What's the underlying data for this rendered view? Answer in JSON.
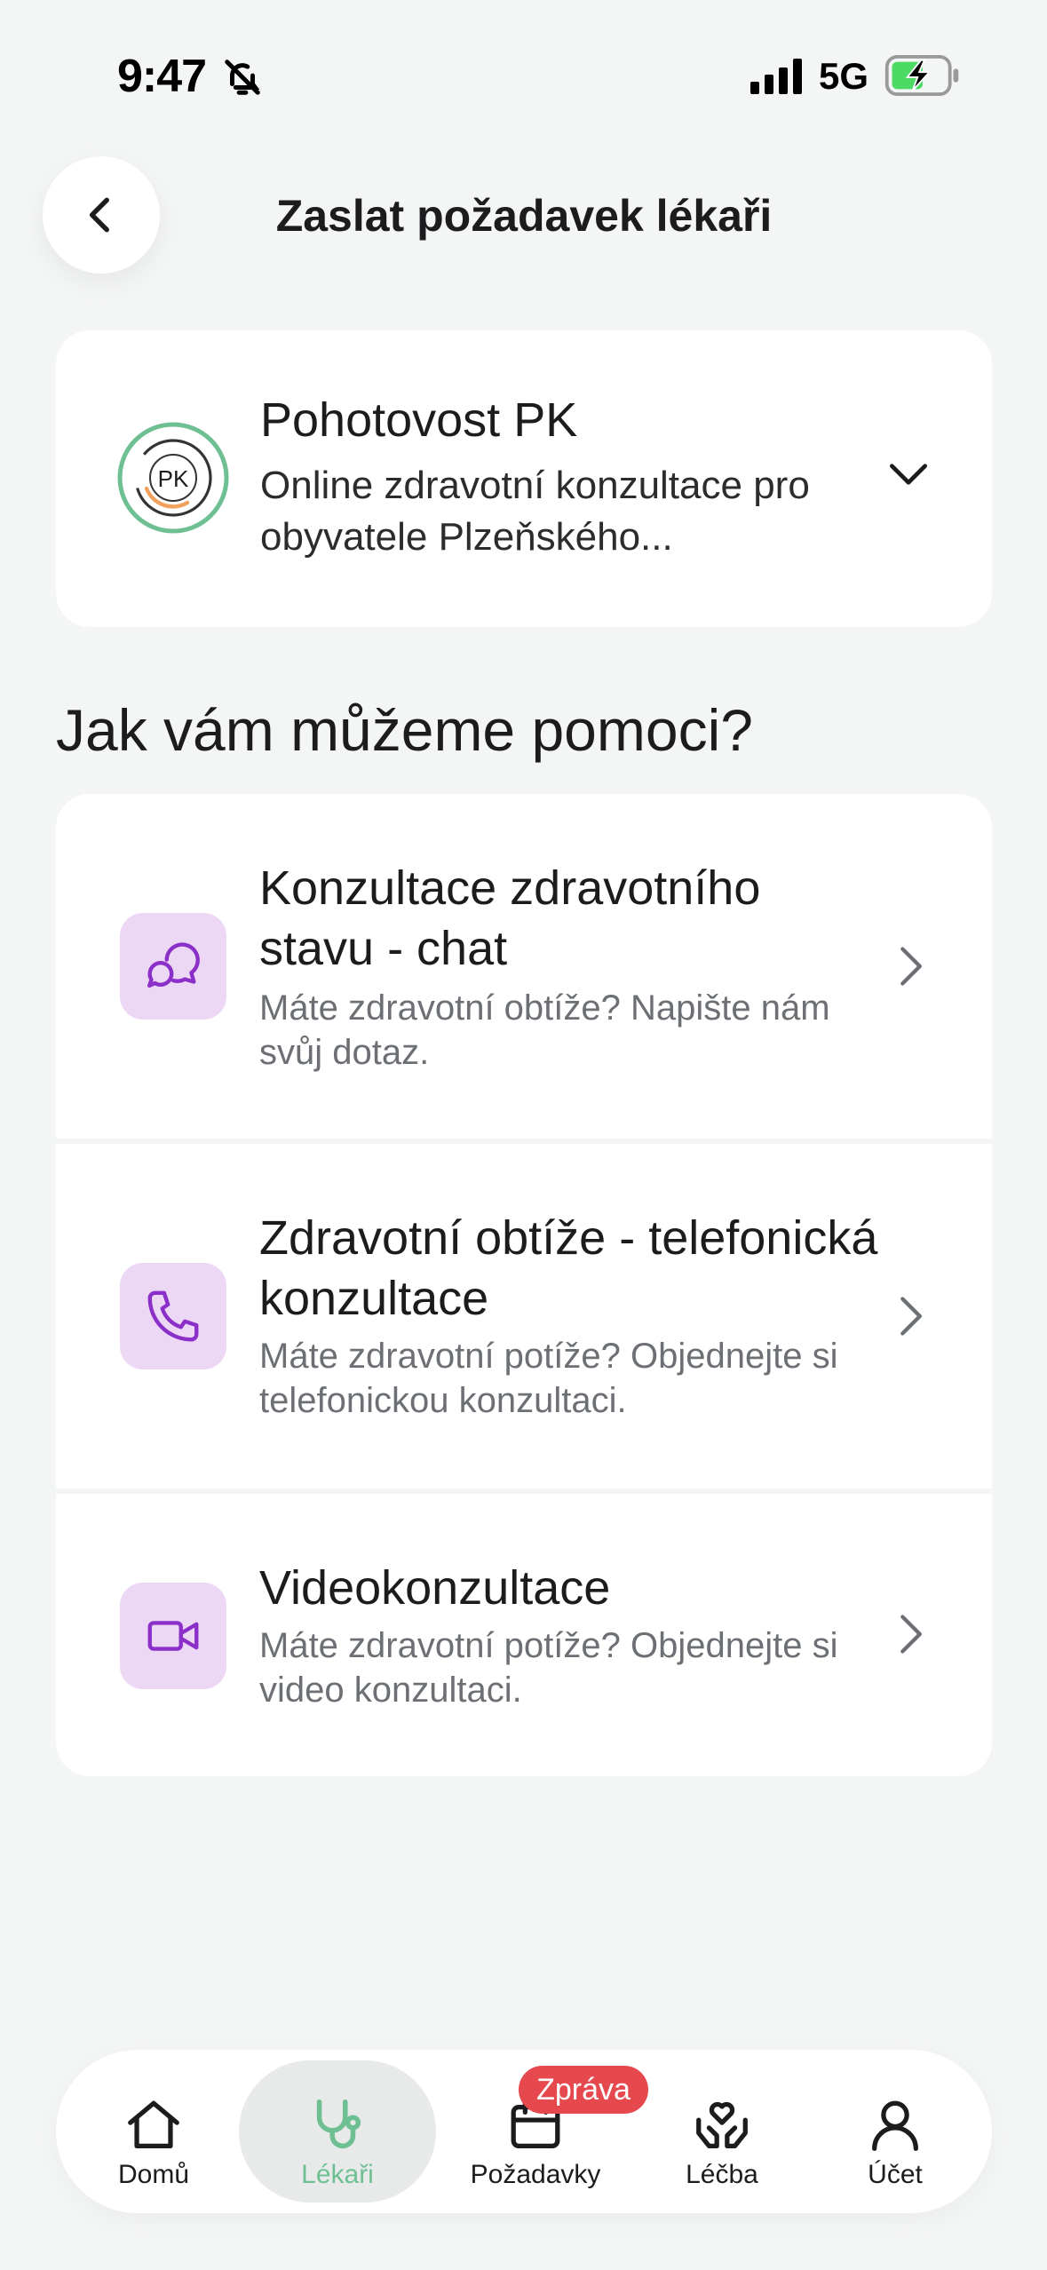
{
  "status_bar": {
    "time": "9:47",
    "network": "5G"
  },
  "header": {
    "title": "Zaslat požadavek lékaři"
  },
  "provider": {
    "logo_text": "PK",
    "name": "Pohotovost PK",
    "description": "Online zdravotní konzultace pro obyvatele Plzeňského...",
    "logo_ring_color": "#6ec093",
    "logo_accent_color": "#f0a15c"
  },
  "section": {
    "heading": "Jak vám můžeme pomoci?"
  },
  "options": [
    {
      "title": "Konzultace zdravotního stavu  - chat",
      "subtitle": "Máte zdravotní obtíže? Napište nám svůj dotaz.",
      "icon": "chat-bubbles-icon"
    },
    {
      "title": "Zdravotní obtíže - telefonická konzultace",
      "subtitle": "Máte zdravotní potíže? Objednejte si telefonickou konzultaci.",
      "icon": "phone-icon"
    },
    {
      "title": "Videokonzultace",
      "subtitle": "Máte zdravotní potíže? Objednejte si video konzultaci.",
      "icon": "video-camera-icon"
    }
  ],
  "tabs": [
    {
      "label": "Domů",
      "icon": "home-icon"
    },
    {
      "label": "Lékaři",
      "icon": "stethoscope-icon",
      "active": true
    },
    {
      "label": "Požadavky",
      "icon": "calendar-icon"
    },
    {
      "label": "Léčba",
      "icon": "heart-hands-icon"
    },
    {
      "label": "Účet",
      "icon": "user-icon"
    }
  ],
  "badge": {
    "text": "Zpráva"
  },
  "colors": {
    "accent_green": "#6ec093",
    "icon_purple": "#8b2fc9",
    "icon_bg": "#ecd7f5",
    "badge_red": "#e5484d",
    "background": "#f4f5f5"
  }
}
